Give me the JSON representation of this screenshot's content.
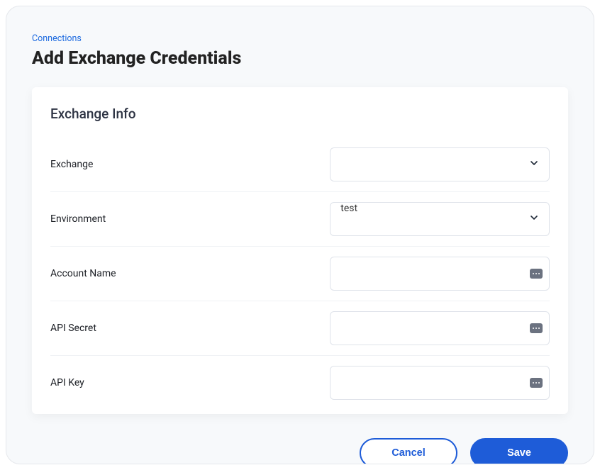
{
  "breadcrumb": "Connections",
  "page_title": "Add Exchange Credentials",
  "card": {
    "title": "Exchange Info",
    "fields": {
      "exchange": {
        "label": "Exchange",
        "value": ""
      },
      "environment": {
        "label": "Environment",
        "value": "test"
      },
      "account_name": {
        "label": "Account Name",
        "value": ""
      },
      "api_secret": {
        "label": "API Secret",
        "value": ""
      },
      "api_key": {
        "label": "API Key",
        "value": ""
      }
    }
  },
  "actions": {
    "cancel": "Cancel",
    "save": "Save"
  }
}
